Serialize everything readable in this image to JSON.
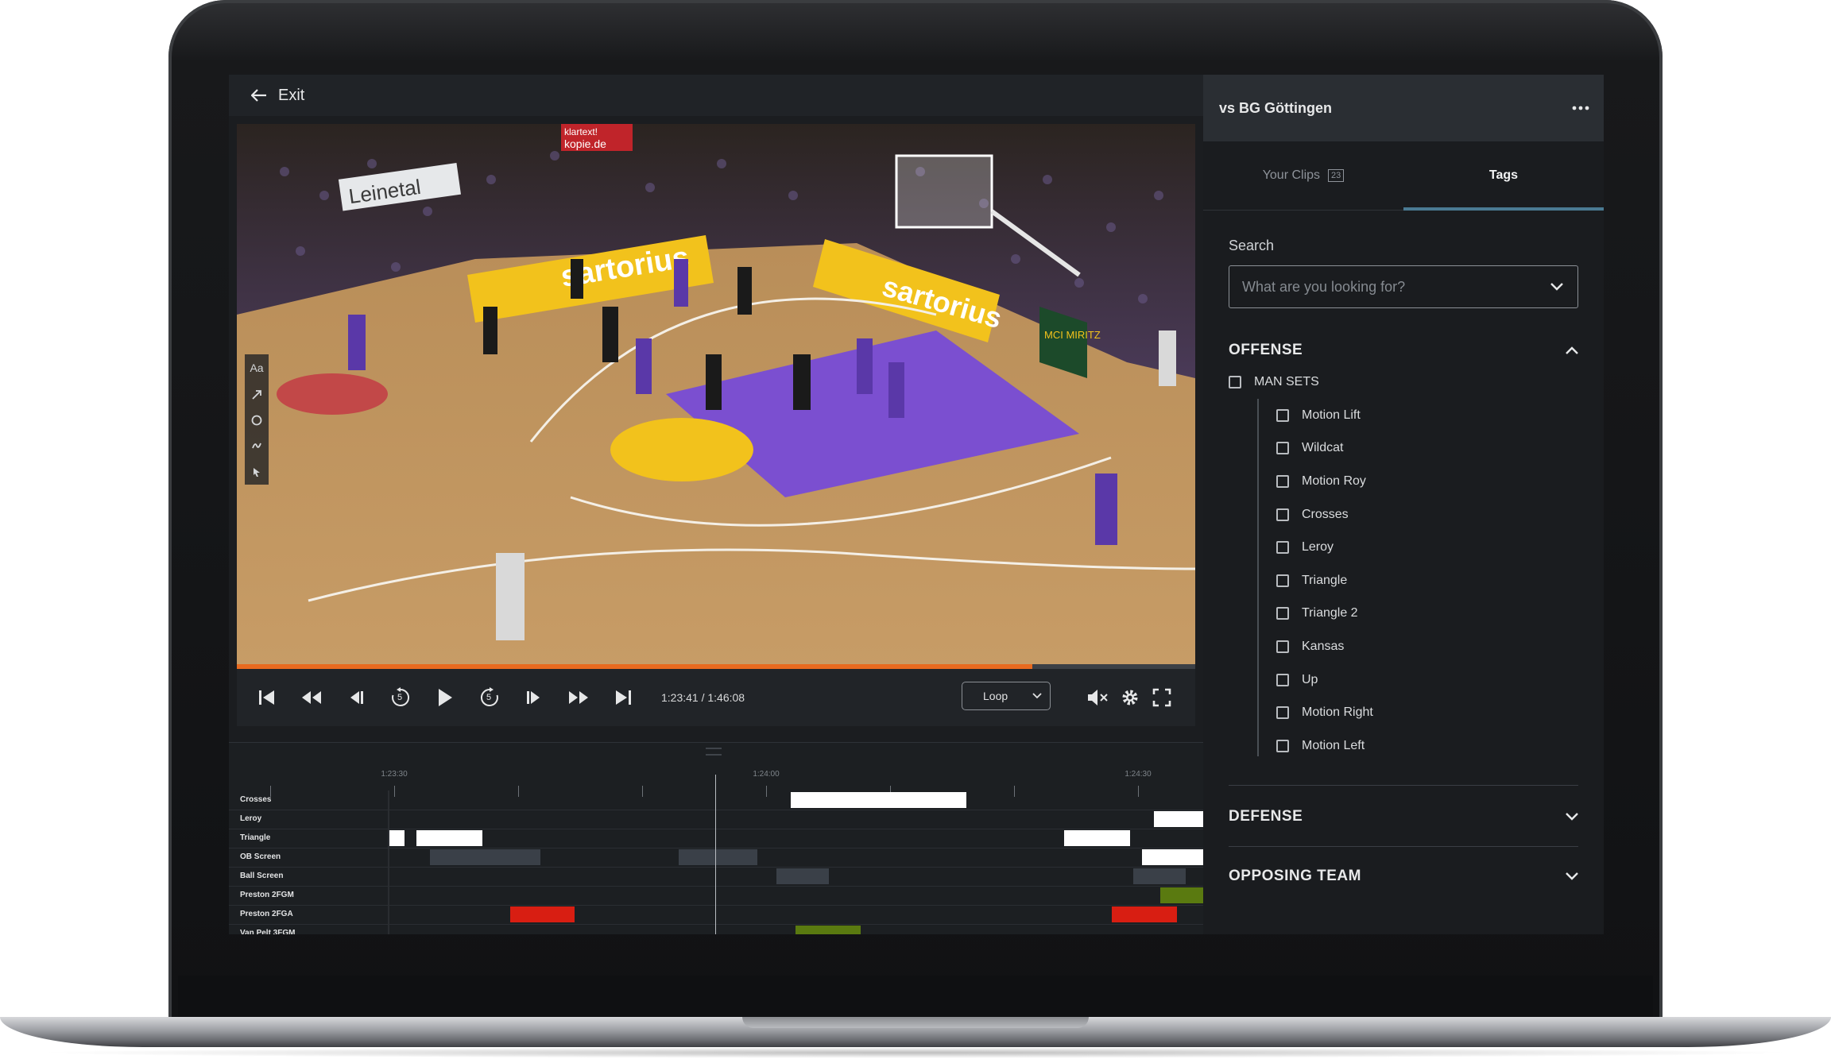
{
  "player": {
    "exit_label": "Exit",
    "timecode": "1:23:41 / 1:46:08",
    "loop_label": "Loop",
    "progress": 0.83,
    "skip_back_seconds": "5",
    "skip_forward_seconds": "5",
    "annotation_tool_text": "Aa"
  },
  "timeline": {
    "tick_labels": [
      "1:23:30",
      "1:24:00",
      "1:24:30"
    ],
    "rows": [
      {
        "label": "Crosses",
        "blocks": [
          {
            "color": "#ffffff",
            "start": 0.493,
            "end": 0.709
          }
        ]
      },
      {
        "label": "Leroy",
        "blocks": [
          {
            "color": "#ffffff",
            "start": 0.939,
            "end": 1.0
          }
        ]
      },
      {
        "label": "Triangle",
        "blocks": [
          {
            "color": "#ffffff",
            "start": 0.0,
            "end": 0.019
          },
          {
            "color": "#ffffff",
            "start": 0.033,
            "end": 0.114
          },
          {
            "color": "#ffffff",
            "start": 0.829,
            "end": 0.91
          }
        ]
      },
      {
        "label": "OB Screen",
        "blocks": [
          {
            "color": "#3a4048",
            "start": 0.05,
            "end": 0.186
          },
          {
            "color": "#3a4048",
            "start": 0.355,
            "end": 0.452
          },
          {
            "color": "#ffffff",
            "start": 0.925,
            "end": 1.0
          }
        ]
      },
      {
        "label": "Ball Screen",
        "blocks": [
          {
            "color": "#3a4048",
            "start": 0.476,
            "end": 0.54
          },
          {
            "color": "#3a4048",
            "start": 0.914,
            "end": 0.979
          }
        ]
      },
      {
        "label": "Preston 2FGM",
        "blocks": [
          {
            "color": "#5a7a10",
            "start": 0.947,
            "end": 1.0
          }
        ]
      },
      {
        "label": "Preston 2FGA",
        "blocks": [
          {
            "color": "#d81e12",
            "start": 0.148,
            "end": 0.228
          },
          {
            "color": "#d81e12",
            "start": 0.888,
            "end": 0.968
          }
        ]
      },
      {
        "label": "Van Pelt 3FGM",
        "blocks": [
          {
            "color": "#5a7a10",
            "start": 0.499,
            "end": 0.579
          }
        ]
      }
    ]
  },
  "sidebar": {
    "title": "vs BG Göttingen",
    "tabs": [
      {
        "label": "Your Clips",
        "badge": "23"
      },
      {
        "label": "Tags"
      }
    ],
    "search_label": "Search",
    "search_placeholder": "What are you looking for?",
    "sections": [
      {
        "title": "OFFENSE",
        "expanded": true,
        "parent": "MAN SETS",
        "tags": [
          "Motion Lift",
          "Wildcat",
          "Motion Roy",
          "Crosses",
          "Leroy",
          "Triangle",
          "Triangle 2",
          "Kansas",
          "Up",
          "Motion Right",
          "Motion Left"
        ]
      },
      {
        "title": "DEFENSE",
        "expanded": false
      },
      {
        "title": "OPPOSING TEAM",
        "expanded": false
      }
    ]
  },
  "video_scene": {
    "banners": [
      "sartorius",
      "sartorius",
      "Leinetal",
      "klartext!",
      "kopie.de",
      "MCI MIRITZ"
    ]
  },
  "colors": {
    "accent_progress": "#e86a1f",
    "tab_underline": "#4a7a93",
    "court_purple": "#7b4fd0"
  }
}
